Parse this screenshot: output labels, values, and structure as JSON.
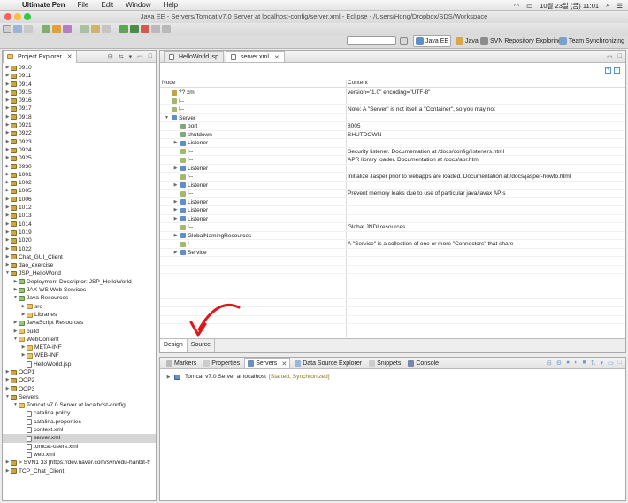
{
  "menubar": {
    "app": "Ultimate Pen",
    "items": [
      "File",
      "Edit",
      "Window",
      "Help"
    ],
    "clock": "10월 23일 (금) 11:01"
  },
  "window": {
    "title": "Java EE - Servers/Tomcat v7.0 Server at localhost-config/server.xml - Eclipse - /Users/Hong/Dropbox/SDS/Workspace"
  },
  "perspectives": {
    "java_ee": "Java EE",
    "java": "Java",
    "svn": "SVN Repository Exploring",
    "team": "Team Synchronizing"
  },
  "project_explorer": {
    "title": "Project Explorer",
    "items": [
      {
        "label": "0910",
        "indent": 0,
        "tw": "▶",
        "icon": "proj"
      },
      {
        "label": "0911",
        "indent": 0,
        "tw": "▶",
        "icon": "proj"
      },
      {
        "label": "0914",
        "indent": 0,
        "tw": "▶",
        "icon": "proj"
      },
      {
        "label": "0915",
        "indent": 0,
        "tw": "▶",
        "icon": "proj"
      },
      {
        "label": "0916",
        "indent": 0,
        "tw": "▶",
        "icon": "proj"
      },
      {
        "label": "0917",
        "indent": 0,
        "tw": "▶",
        "icon": "proj"
      },
      {
        "label": "0918",
        "indent": 0,
        "tw": "▶",
        "icon": "proj"
      },
      {
        "label": "0921",
        "indent": 0,
        "tw": "▶",
        "icon": "proj"
      },
      {
        "label": "0922",
        "indent": 0,
        "tw": "▶",
        "icon": "proj"
      },
      {
        "label": "0923",
        "indent": 0,
        "tw": "▶",
        "icon": "proj"
      },
      {
        "label": "0924",
        "indent": 0,
        "tw": "▶",
        "icon": "proj"
      },
      {
        "label": "0925",
        "indent": 0,
        "tw": "▶",
        "icon": "proj"
      },
      {
        "label": "0930",
        "indent": 0,
        "tw": "▶",
        "icon": "proj"
      },
      {
        "label": "1001",
        "indent": 0,
        "tw": "▶",
        "icon": "proj"
      },
      {
        "label": "1002",
        "indent": 0,
        "tw": "▶",
        "icon": "proj"
      },
      {
        "label": "1005",
        "indent": 0,
        "tw": "▶",
        "icon": "proj"
      },
      {
        "label": "1006",
        "indent": 0,
        "tw": "▶",
        "icon": "proj"
      },
      {
        "label": "1012",
        "indent": 0,
        "tw": "▶",
        "icon": "proj"
      },
      {
        "label": "1013",
        "indent": 0,
        "tw": "▶",
        "icon": "proj"
      },
      {
        "label": "1014",
        "indent": 0,
        "tw": "▶",
        "icon": "proj"
      },
      {
        "label": "1019",
        "indent": 0,
        "tw": "▶",
        "icon": "proj"
      },
      {
        "label": "1020",
        "indent": 0,
        "tw": "▶",
        "icon": "proj"
      },
      {
        "label": "1022",
        "indent": 0,
        "tw": "▶",
        "icon": "proj"
      },
      {
        "label": "Chat_GUI_Client",
        "indent": 0,
        "tw": "▶",
        "icon": "proj"
      },
      {
        "label": "dao_exercise",
        "indent": 0,
        "tw": "▶",
        "icon": "proj"
      },
      {
        "label": "JSP_HelloWorld",
        "indent": 0,
        "tw": "▼",
        "icon": "proj"
      },
      {
        "label": "Deployment Descriptor: JSP_HelloWorld",
        "indent": 1,
        "tw": "▶",
        "icon": "pkg"
      },
      {
        "label": "JAX-WS Web Services",
        "indent": 1,
        "tw": "▶",
        "icon": "pkg"
      },
      {
        "label": "Java Resources",
        "indent": 1,
        "tw": "▼",
        "icon": "pkg"
      },
      {
        "label": "src",
        "indent": 2,
        "tw": "▶",
        "icon": "folder"
      },
      {
        "label": "Libraries",
        "indent": 2,
        "tw": "▶",
        "icon": "folder"
      },
      {
        "label": "JavaScript Resources",
        "indent": 1,
        "tw": "▶",
        "icon": "pkg"
      },
      {
        "label": "build",
        "indent": 1,
        "tw": "▶",
        "icon": "folder"
      },
      {
        "label": "WebContent",
        "indent": 1,
        "tw": "▼",
        "icon": "folder"
      },
      {
        "label": "META-INF",
        "indent": 2,
        "tw": "▶",
        "icon": "folder"
      },
      {
        "label": "WEB-INF",
        "indent": 2,
        "tw": "▶",
        "icon": "folder"
      },
      {
        "label": "HelloWorld.jsp",
        "indent": 2,
        "tw": "",
        "icon": "file"
      },
      {
        "label": "OOP1",
        "indent": 0,
        "tw": "▶",
        "icon": "proj"
      },
      {
        "label": "OOP2",
        "indent": 0,
        "tw": "▶",
        "icon": "proj"
      },
      {
        "label": "OOP3",
        "indent": 0,
        "tw": "▶",
        "icon": "proj"
      },
      {
        "label": "Servers",
        "indent": 0,
        "tw": "▼",
        "icon": "proj"
      },
      {
        "label": "Tomcat v7.0 Server at localhost-config",
        "indent": 1,
        "tw": "▼",
        "icon": "folder"
      },
      {
        "label": "catalina.policy",
        "indent": 2,
        "tw": "",
        "icon": "file"
      },
      {
        "label": "catalina.properties",
        "indent": 2,
        "tw": "",
        "icon": "file"
      },
      {
        "label": "context.xml",
        "indent": 2,
        "tw": "",
        "icon": "file"
      },
      {
        "label": "server.xml",
        "indent": 2,
        "tw": "",
        "icon": "file",
        "selected": true
      },
      {
        "label": "tomcat-users.xml",
        "indent": 2,
        "tw": "",
        "icon": "file"
      },
      {
        "label": "web.xml",
        "indent": 2,
        "tw": "",
        "icon": "file"
      },
      {
        "label": "> SVN1 33 [https://dev.naver.com/svn/edu-hanbit-fr",
        "indent": 0,
        "tw": "▶",
        "icon": "proj"
      },
      {
        "label": "TCP_Chat_Client",
        "indent": 0,
        "tw": "▶",
        "icon": "proj"
      }
    ]
  },
  "editor": {
    "tabs": [
      "HelloWorld.jsp",
      "server.xml"
    ],
    "col_node": "Node",
    "col_content": "Content",
    "rows": [
      {
        "indent": 0,
        "tw": "",
        "icon": "?",
        "node": "?? xml",
        "content": "version=\"1.0\" encoding=\"UTF-8\""
      },
      {
        "indent": 0,
        "tw": "",
        "icon": "c",
        "node": "!--",
        "content": ""
      },
      {
        "indent": 0,
        "tw": "",
        "icon": "c",
        "node": "!--",
        "content": "Note:  A \"Server\" is not itself a \"Container\", so you may not"
      },
      {
        "indent": 0,
        "tw": "▼",
        "icon": "e",
        "node": "Server",
        "content": ""
      },
      {
        "indent": 1,
        "tw": "",
        "icon": "a",
        "node": "port",
        "content": "8005"
      },
      {
        "indent": 1,
        "tw": "",
        "icon": "a",
        "node": "shutdown",
        "content": "SHUTDOWN"
      },
      {
        "indent": 1,
        "tw": "▶",
        "icon": "e",
        "node": "Listener",
        "content": ""
      },
      {
        "indent": 1,
        "tw": "",
        "icon": "c",
        "node": "!--",
        "content": "Security listener. Documentation at /docs/config/listeners.html"
      },
      {
        "indent": 1,
        "tw": "",
        "icon": "c",
        "node": "!--",
        "content": "APR library loader. Documentation at /docs/apr.html"
      },
      {
        "indent": 1,
        "tw": "▶",
        "icon": "e",
        "node": "Listener",
        "content": ""
      },
      {
        "indent": 1,
        "tw": "",
        "icon": "c",
        "node": "!--",
        "content": "Initialize Jasper prior to webapps are loaded. Documentation at /docs/jasper-howto.html"
      },
      {
        "indent": 1,
        "tw": "▶",
        "icon": "e",
        "node": "Listener",
        "content": ""
      },
      {
        "indent": 1,
        "tw": "",
        "icon": "c",
        "node": "!--",
        "content": "Prevent memory leaks due to use of particular java/javax APIs"
      },
      {
        "indent": 1,
        "tw": "▶",
        "icon": "e",
        "node": "Listener",
        "content": ""
      },
      {
        "indent": 1,
        "tw": "▶",
        "icon": "e",
        "node": "Listener",
        "content": ""
      },
      {
        "indent": 1,
        "tw": "▶",
        "icon": "e",
        "node": "Listener",
        "content": ""
      },
      {
        "indent": 1,
        "tw": "",
        "icon": "c",
        "node": "!--",
        "content": "Global JNDI resources"
      },
      {
        "indent": 1,
        "tw": "▶",
        "icon": "e",
        "node": "GlobalNamingResources",
        "content": ""
      },
      {
        "indent": 1,
        "tw": "",
        "icon": "c",
        "node": "!--",
        "content": "A \"Service\" is a collection of one or more \"Connectors\" that share"
      },
      {
        "indent": 1,
        "tw": "▶",
        "icon": "e",
        "node": "Service",
        "content": ""
      }
    ],
    "bottom_tabs": [
      "Design",
      "Source"
    ]
  },
  "servers_view": {
    "tabs": [
      "Markers",
      "Properties",
      "Servers",
      "Data Source Explorer",
      "Snippets",
      "Console"
    ],
    "server_name": "Tomcat v7.0 Server at localhost",
    "server_status": "[Started, Synchronized]"
  },
  "colors": {
    "annotation_arrow": "#e0161b"
  }
}
